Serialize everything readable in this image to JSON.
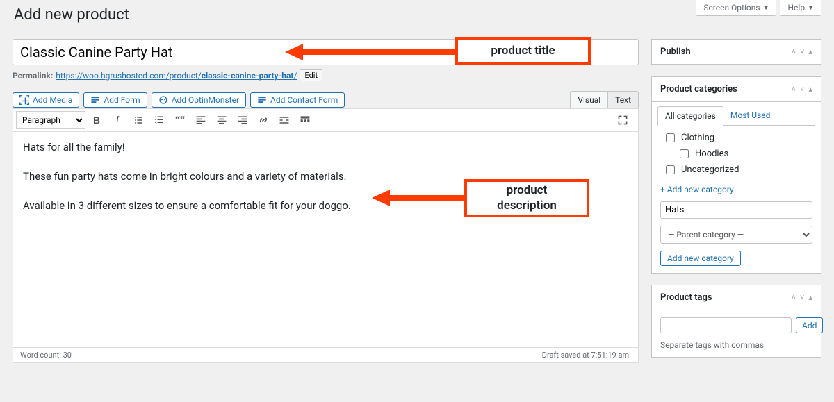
{
  "screen_meta": {
    "options": "Screen Options",
    "help": "Help"
  },
  "heading": "Add new product",
  "title_value": "Classic Canine Party Hat",
  "permalink": {
    "label": "Permalink:",
    "base": "https://woo.hgrushosted.com/product/",
    "slug": "classic-canine-party-hat",
    "trail": "/",
    "edit": "Edit"
  },
  "media_buttons": {
    "media": "Add Media",
    "form": "Add Form",
    "optin": "Add OptinMonster",
    "contact": "Add Contact Form"
  },
  "editor_tabs": {
    "visual": "Visual",
    "text": "Text"
  },
  "format_select": "Paragraph",
  "content": {
    "p1": "Hats for all the family!",
    "p2": "These fun party hats come in bright colours and a variety of materials.",
    "p3": "Available in 3 different sizes to ensure a comfortable fit for your doggo."
  },
  "status": {
    "wordcount_label": "Word count:",
    "wordcount": "30",
    "draft": "Draft saved at 7:51:19 am."
  },
  "side": {
    "publish": "Publish",
    "categories": {
      "title": "Product categories",
      "tab_all": "All categories",
      "tab_most": "Most Used",
      "items": [
        "Clothing",
        "Hoodies",
        "Uncategorized"
      ],
      "addlink": "+ Add new category",
      "new_value": "Hats",
      "parent": "— Parent category —",
      "addbtn": "Add new category"
    },
    "tags": {
      "title": "Product tags",
      "add": "Add",
      "hint": "Separate tags with commas"
    }
  },
  "annotations": {
    "title": "product title",
    "desc": "product\ndescription"
  }
}
